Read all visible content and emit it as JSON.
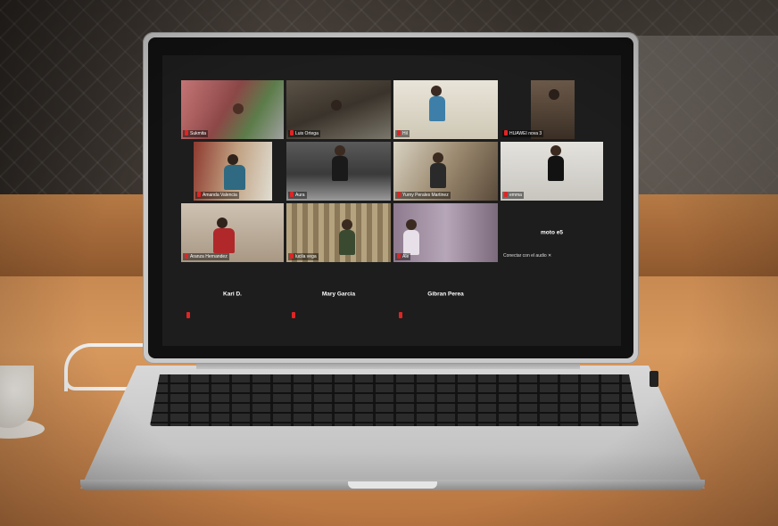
{
  "participants": [
    {
      "name": "Sukmita",
      "tone": "#c56a5a"
    },
    {
      "name": "Luis Ortega",
      "tone": "#4d4438"
    },
    {
      "name": "Hil",
      "tone": "#d9d4c6"
    },
    {
      "name": "HUAWEI nova 3",
      "tone": "#3a2f27"
    },
    {
      "name": "Amanda Valencia",
      "tone": "#8e3a2f"
    },
    {
      "name": "Aura",
      "tone": "#4b4a4a"
    },
    {
      "name": "Yurny Perales Martinez",
      "tone": "#7a6a55"
    },
    {
      "name": "emma",
      "tone": "#d6d4d0"
    },
    {
      "name": "Aranza Hernandez",
      "tone": "#c9b9a8"
    },
    {
      "name": "lucila vega",
      "tone": "#9c8a6a"
    },
    {
      "name": "Ale",
      "tone": "#b2a4b6"
    },
    {
      "name": "moto e5",
      "tip": "Conectar con el audio",
      "close": "✕"
    },
    {
      "name": "Kari D."
    },
    {
      "name": "Mary Garcia"
    },
    {
      "name": "Gibran Perea"
    }
  ]
}
